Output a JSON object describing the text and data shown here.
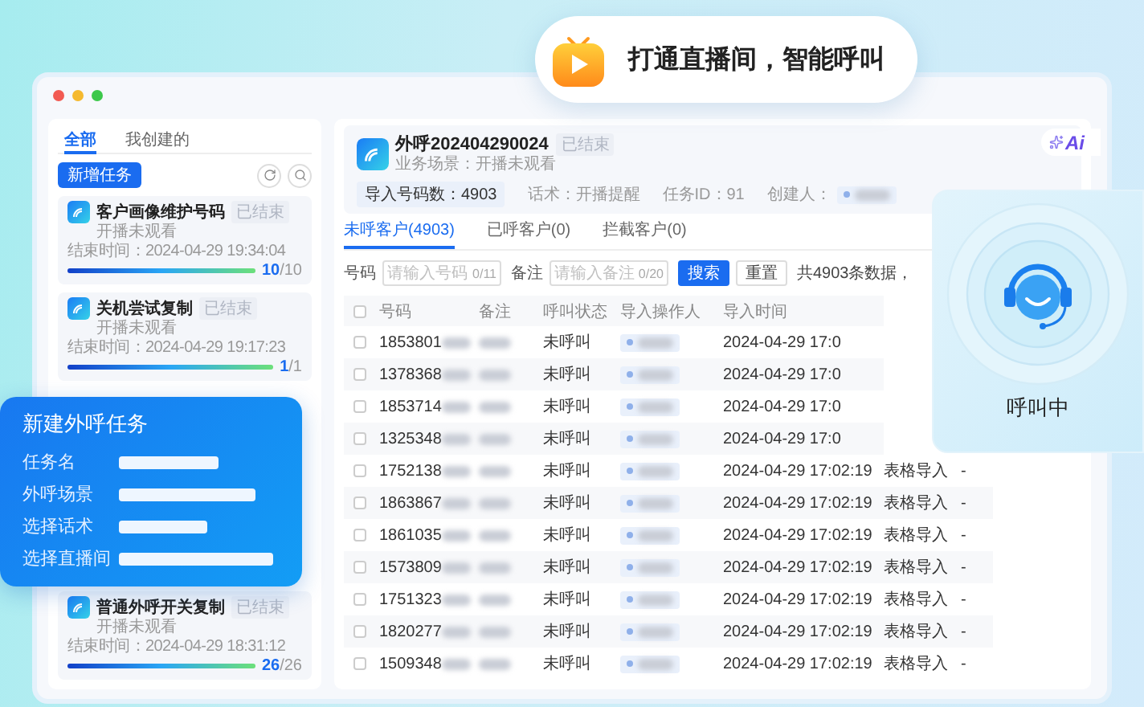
{
  "banner": {
    "text": "打通直播间，智能呼叫"
  },
  "ai_badge": {
    "text": "Ai"
  },
  "sidebar": {
    "tabs": [
      {
        "label": "全部",
        "selected": true
      },
      {
        "label": "我创建的",
        "selected": false
      }
    ],
    "add_button": "新增任务",
    "tasks": [
      {
        "title": "客户画像维护号码",
        "status": "已结束",
        "scene": "开播未观看",
        "end_time": "结束时间：2024-04-29 19:34:04",
        "level": 1,
        "count": "10",
        "total": "/10"
      },
      {
        "title": "关机尝试复制",
        "status": "已结束",
        "scene": "开播未观看",
        "end_time": "结束时间：2024-04-29 19:17:23",
        "level": 1,
        "count": "1",
        "total": "/1"
      },
      {
        "title": "普通外呼开关复制",
        "status": "已结束",
        "scene": "开播未观看",
        "end_time": "结束时间：2024-04-29 18:31:12",
        "level": 1,
        "count": "26",
        "total": "/26"
      }
    ]
  },
  "task": {
    "title": "外呼202404290024",
    "status": "已结束",
    "scene": "业务场景：开播未观看",
    "stats": [
      {
        "kind": "chip",
        "text": "导入号码数：4903"
      },
      {
        "kind": "plain",
        "text": "话术：开播提醒"
      },
      {
        "kind": "plain",
        "text": "任务ID：91"
      },
      {
        "kind": "creator",
        "text": "创建人："
      }
    ]
  },
  "tabs": [
    {
      "label": "未呼客户(4903)",
      "selected": true
    },
    {
      "label": "已呼客户(0)",
      "selected": false
    },
    {
      "label": "拦截客户(0)",
      "selected": false
    }
  ],
  "filters": [
    {
      "label": "号码",
      "placeholder": "请输入号码",
      "counter": "0/11"
    },
    {
      "label": "备注",
      "placeholder": "请输入备注",
      "counter": "0/20"
    }
  ],
  "search_button": "搜索",
  "reset_button": "重置",
  "total": "共4903条数据，",
  "table": {
    "all_checked": false,
    "columns": [
      "号码",
      "备注",
      "呼叫状态",
      "导入操作人",
      "导入时间"
    ],
    "rows": [
      {
        "checked": false,
        "phone": "1853801",
        "status": "未呼叫",
        "time": "2024-04-29 17:0"
      },
      {
        "checked": false,
        "phone": "1378368",
        "status": "未呼叫",
        "time": "2024-04-29 17:0"
      },
      {
        "checked": false,
        "phone": "1853714",
        "status": "未呼叫",
        "time": "2024-04-29 17:0"
      },
      {
        "checked": false,
        "phone": "1325348",
        "status": "未呼叫",
        "time": "2024-04-29 17:0"
      },
      {
        "checked": false,
        "phone": "1752138",
        "status": "未呼叫",
        "time": "2024-04-29 17:02:19",
        "source": "表格导入",
        "extra": "-"
      },
      {
        "checked": false,
        "phone": "1863867",
        "status": "未呼叫",
        "time": "2024-04-29 17:02:19",
        "source": "表格导入",
        "extra": "-"
      },
      {
        "checked": false,
        "phone": "1861035",
        "status": "未呼叫",
        "time": "2024-04-29 17:02:19",
        "source": "表格导入",
        "extra": "-"
      },
      {
        "checked": false,
        "phone": "1573809",
        "status": "未呼叫",
        "time": "2024-04-29 17:02:19",
        "source": "表格导入",
        "extra": "-"
      },
      {
        "checked": false,
        "phone": "1751323",
        "status": "未呼叫",
        "time": "2024-04-29 17:02:19",
        "source": "表格导入",
        "extra": "-"
      },
      {
        "checked": false,
        "phone": "1820277",
        "status": "未呼叫",
        "time": "2024-04-29 17:02:19",
        "source": "表格导入",
        "extra": "-"
      },
      {
        "checked": false,
        "phone": "1509348",
        "status": "未呼叫",
        "time": "2024-04-29 17:02:19",
        "source": "表格导入",
        "extra": "-"
      }
    ]
  },
  "call_card": {
    "status": "呼叫中"
  },
  "new_task_popup": {
    "title": "新建外呼任务",
    "fields": [
      "任务名",
      "外呼场景",
      "选择话术",
      "选择直播间"
    ]
  }
}
